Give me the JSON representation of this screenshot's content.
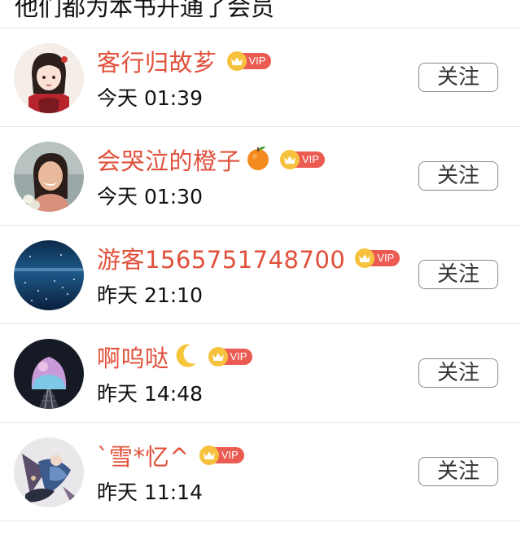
{
  "header": {
    "title": "他们都为本书开通了会员"
  },
  "vip_badge": {
    "label": "VIP"
  },
  "colors": {
    "name": "#e0503a",
    "vip_bg": "#ec5b52",
    "crown": "#f6c23e"
  },
  "members": [
    {
      "name": "客行归故芗",
      "emoji": "",
      "time": "今天 01:39",
      "follow_label": "关注",
      "avatar_icon": "girl-illustration-avatar"
    },
    {
      "name": "会哭泣的橙子",
      "emoji": "orange",
      "time": "今天 01:30",
      "follow_label": "关注",
      "avatar_icon": "smiling-woman-photo-avatar"
    },
    {
      "name": "游客1565751748700",
      "emoji": "",
      "time": "昨天 21:10",
      "follow_label": "关注",
      "avatar_icon": "starry-blue-sky-avatar"
    },
    {
      "name": "啊呜哒",
      "emoji": "crescent-moon",
      "time": "昨天 14:48",
      "follow_label": "关注",
      "avatar_icon": "tunnel-railway-avatar"
    },
    {
      "name": "`雪*忆^",
      "emoji": "",
      "time": "昨天 11:14",
      "follow_label": "关注",
      "avatar_icon": "anime-character-avatar"
    }
  ]
}
